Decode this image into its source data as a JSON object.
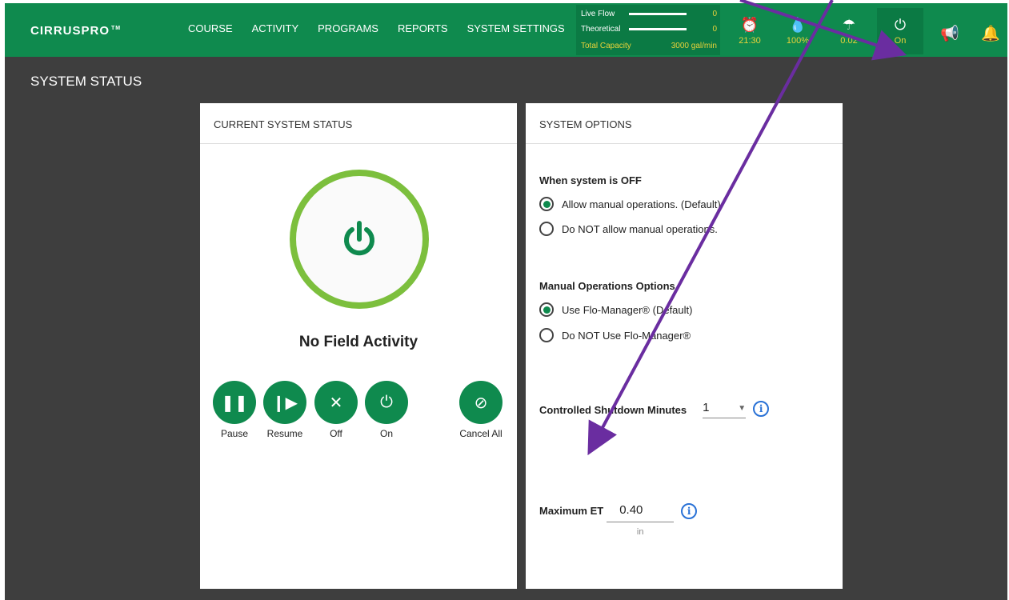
{
  "header": {
    "logo_main": "CIRRUS",
    "logo_pro": "PRO",
    "logo_tm": "TM",
    "nav": [
      "COURSE",
      "ACTIVITY",
      "PROGRAMS",
      "REPORTS",
      "SYSTEM SETTINGS"
    ],
    "flow": {
      "live_label": "Live Flow",
      "live_value": "0",
      "theoretical_label": "Theoretical",
      "theoretical_value": "0",
      "capacity_label": "Total Capacity",
      "capacity_value": "3000 gal/min"
    },
    "stats": [
      {
        "icon": "alarm-clock-icon",
        "value": "21:30"
      },
      {
        "icon": "water-drop-icon",
        "value": "100%"
      },
      {
        "icon": "rain-gauge-icon",
        "value": "0.02"
      },
      {
        "icon": "power-icon",
        "value": "On"
      }
    ]
  },
  "page": {
    "title": "SYSTEM STATUS"
  },
  "status_card": {
    "title": "CURRENT SYSTEM STATUS",
    "activity": "No Field Activity",
    "controls": [
      {
        "label": "Pause",
        "icon": "pause-icon"
      },
      {
        "label": "Resume",
        "icon": "resume-icon"
      },
      {
        "label": "Off",
        "icon": "off-x-icon"
      },
      {
        "label": "On",
        "icon": "power-icon"
      },
      {
        "label": "Cancel All",
        "icon": "cancel-all-icon"
      }
    ],
    "accent": "#0f8a4e",
    "ring": "#7cbf3d"
  },
  "options_card": {
    "title": "SYSTEM OPTIONS",
    "when_off": {
      "heading": "When system is OFF",
      "options": [
        "Allow manual operations. (Default)",
        "Do NOT allow manual operations."
      ],
      "selected": 0
    },
    "manual_ops": {
      "heading": "Manual Operations Options",
      "options": [
        "Use Flo-Manager® (Default)",
        "Do NOT Use Flo-Manager®"
      ],
      "selected": 0
    },
    "shutdown": {
      "label": "Controlled Shutdown Minutes",
      "value": "1"
    },
    "max_et": {
      "label": "Maximum ET",
      "value": "0.40",
      "unit": "in"
    }
  }
}
